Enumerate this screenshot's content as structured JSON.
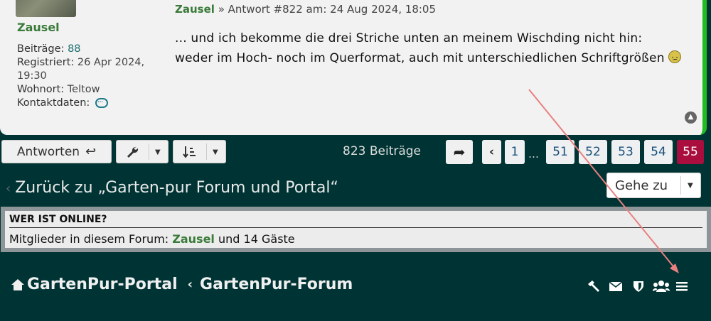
{
  "post": {
    "author": "Zausel",
    "profile": {
      "posts_label": "Beiträge:",
      "posts_value": "88",
      "registered_label": "Registriert:",
      "registered_value": "26 Apr 2024,",
      "registered_time": "19:30",
      "location_label": "Wohnort:",
      "location_value": "Teltow",
      "contact_label": "Kontaktdaten:"
    },
    "header_author": "Zausel",
    "header_rest": "» Antwort #822 am: 24 Aug 2024, 18:05",
    "body_line1": "... und ich bekomme die drei Striche unten an meinem Wischding nicht hin:",
    "body_line2": "weder im Hoch- noch im Querformat, auch mit unterschiedlichen Schriftgrößen"
  },
  "actions": {
    "reply_label": "Antworten",
    "total_posts": "823 Beiträge",
    "pages": [
      "1",
      "51",
      "52",
      "53",
      "54",
      "55"
    ],
    "current_page": "55",
    "ellipsis": "…"
  },
  "nav": {
    "back_link": "Zurück zu „Garten-pur Forum und Portal“",
    "jump_label": "Gehe zu"
  },
  "online": {
    "title": "WER IST ONLINE?",
    "prefix": "Mitglieder in diesem Forum:",
    "member": "Zausel",
    "suffix": "und 14 Gäste"
  },
  "footer": {
    "portal": "GartenPur-Portal",
    "forum": "GartenPur-Forum",
    "icons": [
      "hammer-icon",
      "envelope-icon",
      "shield-icon",
      "users-icon",
      "menu-icon"
    ]
  },
  "colors": {
    "background": "#003333",
    "accent_green": "#3a7a3a",
    "active_page": "#aa0e3f",
    "annotation_arrow": "#e88080"
  }
}
